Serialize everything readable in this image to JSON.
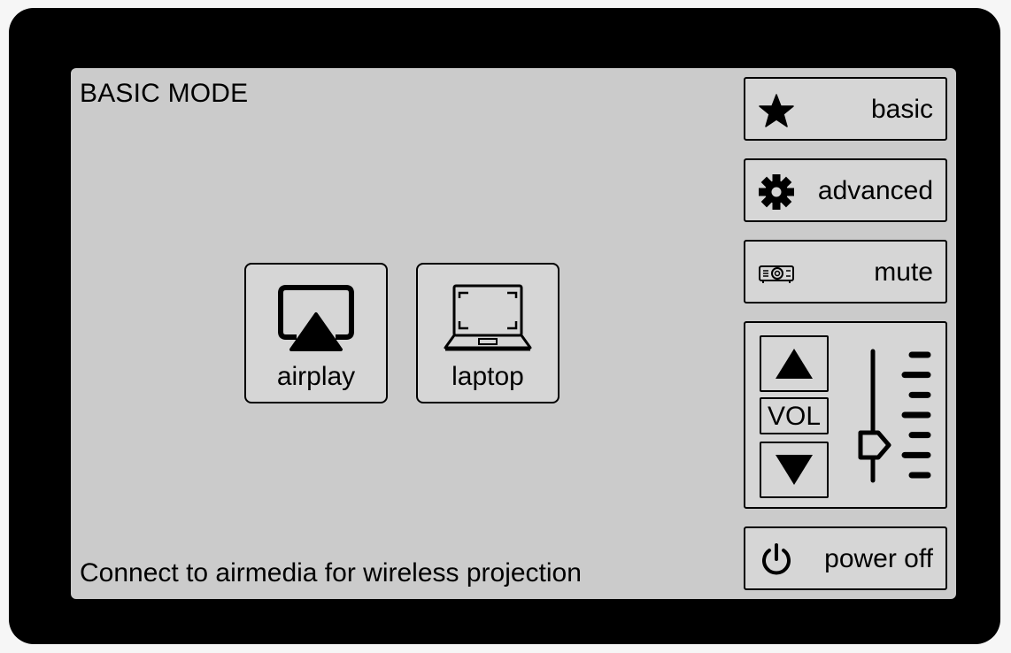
{
  "screen": {
    "mode_title": "BASIC MODE",
    "status_text": "Connect to airmedia for wireless projection"
  },
  "sources": [
    {
      "label": "airplay",
      "icon": "airplay-icon"
    },
    {
      "label": "laptop",
      "icon": "laptop-icon"
    }
  ],
  "sidebar": {
    "basic": {
      "label": "basic",
      "icon": "star-icon"
    },
    "advanced": {
      "label": "advanced",
      "icon": "gear-icon"
    },
    "mute": {
      "label": "mute",
      "icon": "projector-icon"
    },
    "power": {
      "label": "power off",
      "icon": "power-icon"
    }
  },
  "volume": {
    "label": "VOL",
    "level": 0.25,
    "up_icon": "triangle-up-icon",
    "down_icon": "triangle-down-icon"
  },
  "colors": {
    "bezel": "#000000",
    "screen": "#cbcbcb",
    "button": "#d6d6d6"
  }
}
